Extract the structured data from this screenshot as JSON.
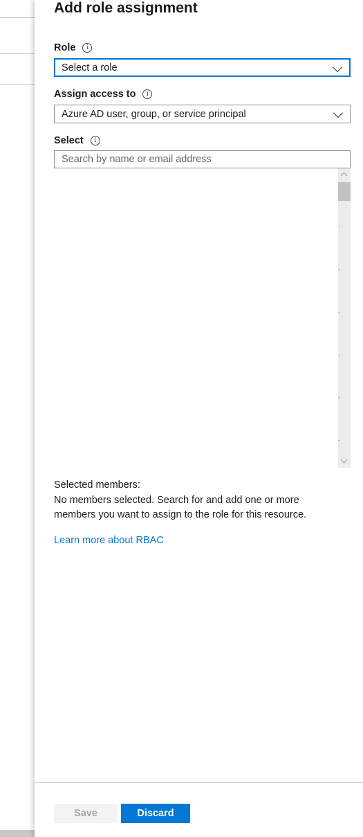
{
  "blade": {
    "title": "Add role assignment"
  },
  "role": {
    "label": "Role",
    "value": "Select a role"
  },
  "assign_access": {
    "label": "Assign access to",
    "value": "Azure AD user, group, or service principal"
  },
  "select": {
    "label": "Select",
    "placeholder": "Search by name or email address"
  },
  "selected_members": {
    "label": "Selected members:",
    "message": "No members selected. Search for and add one or more members you want to assign to the role for this resource."
  },
  "learn_more": "Learn more about RBAC",
  "footer": {
    "save_label": "Save",
    "discard_label": "Discard"
  },
  "colors": {
    "accent": "#0078d4",
    "disabled_bg": "#f3f3f3",
    "disabled_text": "#a6a6a6"
  },
  "icons": {
    "info": "info-icon",
    "dropdown": "chevron-down-icon"
  }
}
